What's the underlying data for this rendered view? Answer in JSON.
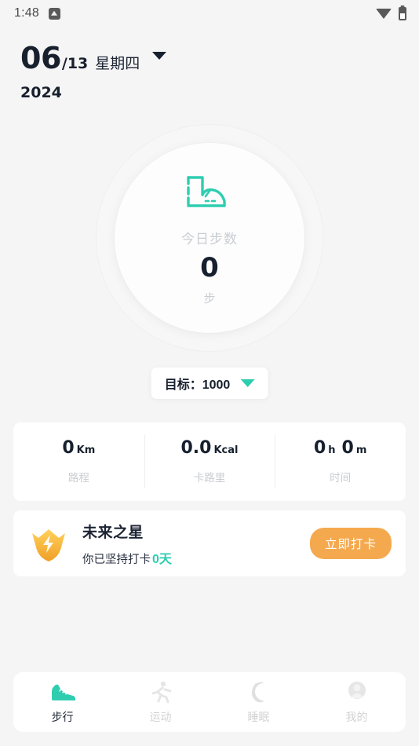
{
  "statusbar": {
    "time": "1:48",
    "app_icon": "notification-app-icon",
    "wifi_icon": "wifi-icon",
    "battery_icon": "battery-icon"
  },
  "header": {
    "month": "06",
    "day": "/13",
    "weekday": "星期四",
    "year": "2024",
    "caret_icon": "chevron-down-icon"
  },
  "ring": {
    "boot_icon": "boot-icon",
    "label": "今日步数",
    "value": "0",
    "unit": "步"
  },
  "goal": {
    "text": "目标：1000",
    "caret_icon": "chevron-down-icon",
    "accent_color": "#2ecdb0"
  },
  "stats": [
    {
      "value": "0",
      "unit": "Km",
      "label": "路程"
    },
    {
      "value": "0.0",
      "unit": "Kcal",
      "label": "卡路里"
    },
    {
      "value": "0",
      "unit": "h",
      "value2": "0",
      "unit2": "m",
      "label": "时间"
    }
  ],
  "checkin": {
    "badge_icon": "shield-bolt-badge-icon",
    "title": "未来之星",
    "subtitle": "你已坚持打卡",
    "days": "0天",
    "days_color": "#2ecdb0",
    "button_label": "立即打卡",
    "button_color": "#f5a94e"
  },
  "bottomnav": {
    "items": [
      {
        "label": "步行",
        "icon": "sneaker-icon",
        "active": true
      },
      {
        "label": "运动",
        "icon": "running-icon",
        "active": false
      },
      {
        "label": "睡眠",
        "icon": "moon-icon",
        "active": false
      },
      {
        "label": "我的",
        "icon": "person-icon",
        "active": false
      }
    ]
  }
}
